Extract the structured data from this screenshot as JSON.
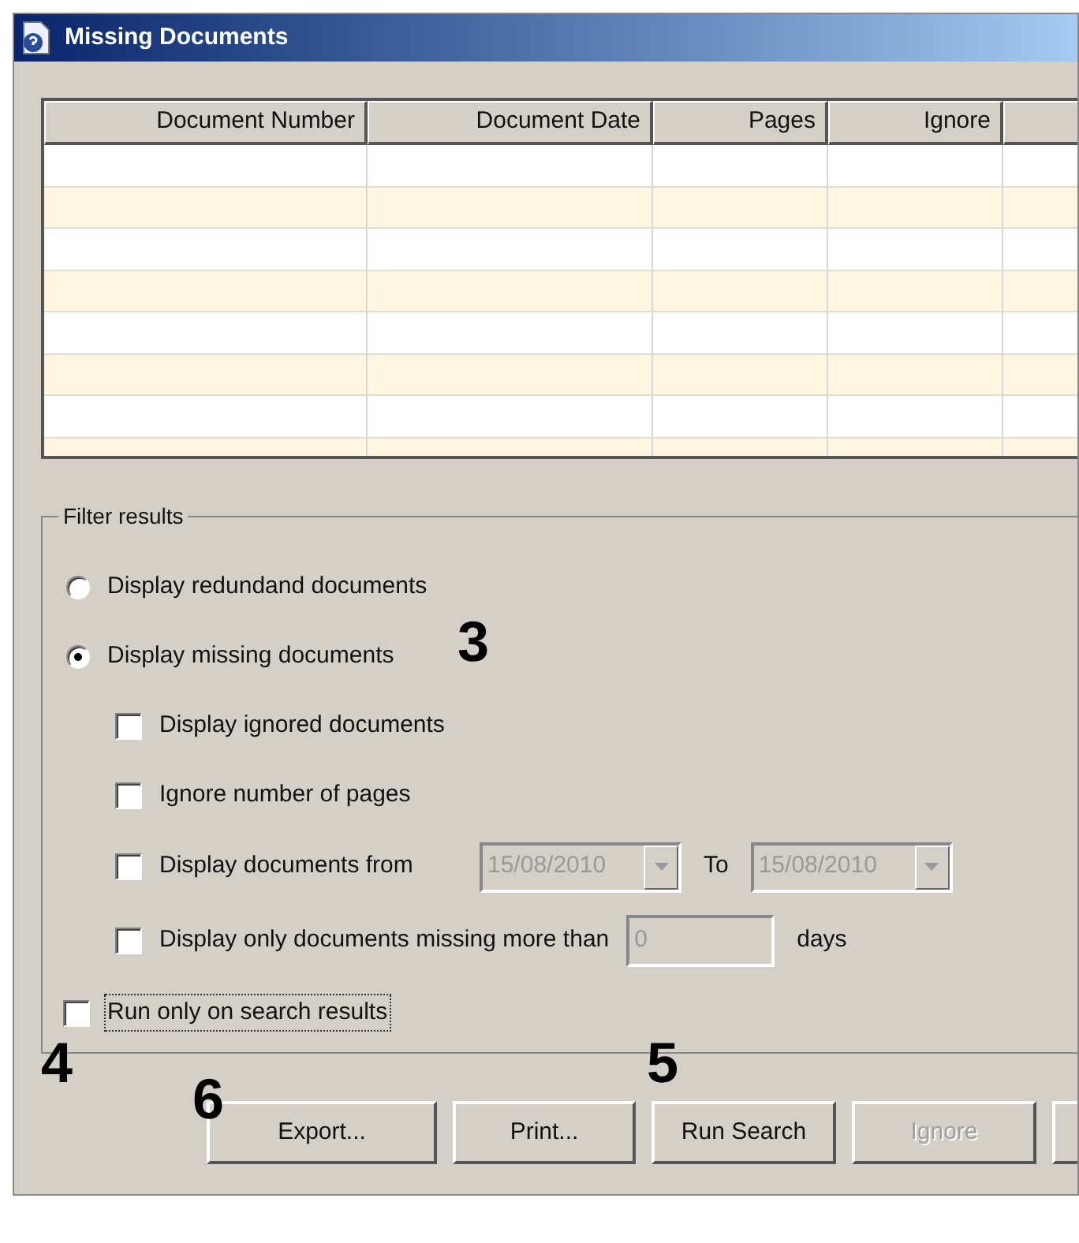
{
  "window": {
    "title": "Missing Documents"
  },
  "table": {
    "columns": [
      "Document Number",
      "Document Date",
      "Pages",
      "Ignore"
    ]
  },
  "filter": {
    "legend": "Filter results",
    "options": [
      {
        "kind": "radio",
        "label": "Display redundand documents",
        "selected": false
      },
      {
        "kind": "radio",
        "label": "Display missing documents",
        "selected": true,
        "children": [
          {
            "kind": "checkbox",
            "label": "Display ignored documents",
            "checked": false
          },
          {
            "kind": "checkbox",
            "label": "Ignore number of pages",
            "checked": false
          },
          {
            "kind": "date_range",
            "label": "Display documents from",
            "checked": false,
            "from": {
              "value": "15/08/2010",
              "disabled": true
            },
            "to_label": "To",
            "to": {
              "value": "15/08/2010",
              "disabled": true
            }
          },
          {
            "kind": "days",
            "label": "Display only documents missing more than",
            "checked": false,
            "field": {
              "value": "0",
              "disabled": true
            },
            "unit": "days"
          }
        ]
      }
    ],
    "run_only": {
      "label": "Run only on search results",
      "checked": false,
      "focused": true
    }
  },
  "buttons": [
    {
      "label": "Export...",
      "disabled": false
    },
    {
      "label": "Print...",
      "disabled": false
    },
    {
      "label": "Run Search",
      "disabled": false
    },
    {
      "label": "Ignore",
      "disabled": true
    }
  ],
  "callouts": [
    "3",
    "4",
    "5",
    "6"
  ]
}
